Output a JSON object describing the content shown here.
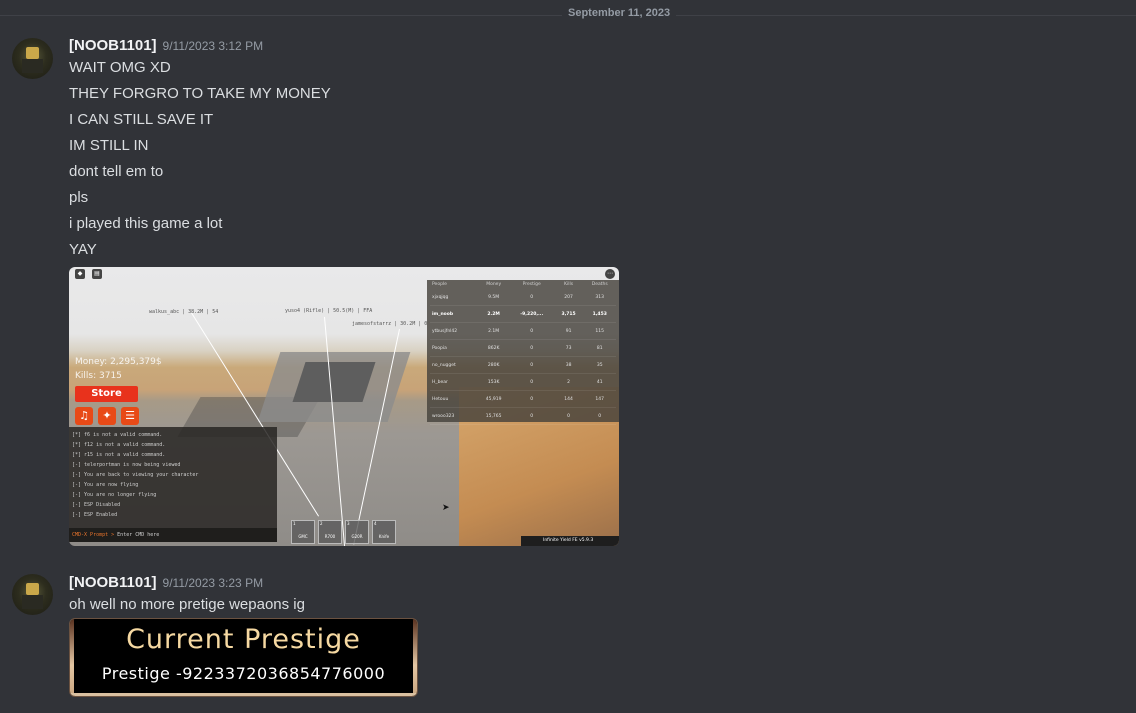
{
  "divider": {
    "date": "September 11, 2023"
  },
  "messages": [
    {
      "author": "[NOOB1101]",
      "timestamp": "9/11/2023 3:12 PM",
      "lines": [
        "WAIT OMG XD",
        "THEY FORGRO TO TAKE MY MONEY",
        "I CAN STILL SAVE IT",
        "IM STILL IN",
        "dont tell em to",
        "pls",
        "i played this game a lot",
        "YAY"
      ]
    },
    {
      "author": "[NOOB1101]",
      "timestamp": "9/11/2023 3:23 PM",
      "lines": [
        "oh well no more pretige wepaons ig"
      ]
    }
  ],
  "game": {
    "hud": {
      "money": "Money: 2,295,379$",
      "kills": "Kills: 3715",
      "store": "Store"
    },
    "icons": [
      "music-icon",
      "twitter-icon",
      "list-icon"
    ],
    "console_lines": [
      "[*] f6 is not a valid command.",
      "[*] f12 is not a valid command.",
      "[*] r15 is not a valid command.",
      "[-] telerportman is now being viewed",
      "[-] You are back to viewing your character",
      "[-] You are now flying",
      "[-] You are no longer flying",
      "[-] ESP Disabled",
      "[-] ESP Enabled"
    ],
    "prompt": {
      "prefix": "CMD-X Prompt >",
      "placeholder": "Enter CMD here"
    },
    "player_tags": [
      "walkus_abc | 38.2M | 54",
      "yuso4 (Rifle) | 50.5(M) | FFA",
      "jamesofstarrz | 30.2M | 0"
    ],
    "leaderboard": {
      "headers": [
        "People",
        "Money",
        "Prestige",
        "Kills",
        "Deaths"
      ],
      "rows": [
        [
          "xjxqjqg",
          "9.5M",
          "0",
          "207",
          "313"
        ],
        [
          "im_noob",
          "2.2M",
          "-9,220,...",
          "3,715",
          "1,453"
        ],
        [
          "ytbusjfnl42",
          "2.1M",
          "0",
          "91",
          "115"
        ],
        [
          "Poopia",
          "862K",
          "0",
          "73",
          "81"
        ],
        [
          "no_nugget",
          "280K",
          "0",
          "38",
          "35"
        ],
        [
          "H_bear",
          "153K",
          "0",
          "2",
          "41"
        ],
        [
          "Hetouu",
          "45,919",
          "0",
          "144",
          "147"
        ],
        [
          "wrooo323",
          "15,765",
          "0",
          "0",
          "0"
        ]
      ],
      "highlight_row": 1
    },
    "hotbar": [
      {
        "num": "1",
        "label": "GMC"
      },
      {
        "num": "2",
        "label": "R700"
      },
      {
        "num": "3",
        "label": "G20R"
      },
      {
        "num": "4",
        "label": "Knife"
      }
    ],
    "infinite_yield": "Infinite Yield FE v5.9.3"
  },
  "prestige_card": {
    "title": "Current Prestige",
    "value": "Prestige -9223372036854776000"
  },
  "colors": {
    "background": "#313338",
    "username": "#f2f3f5",
    "timestamp": "#949ba4",
    "text": "#dbdee1",
    "prestige_title": "#f6d9a2"
  }
}
